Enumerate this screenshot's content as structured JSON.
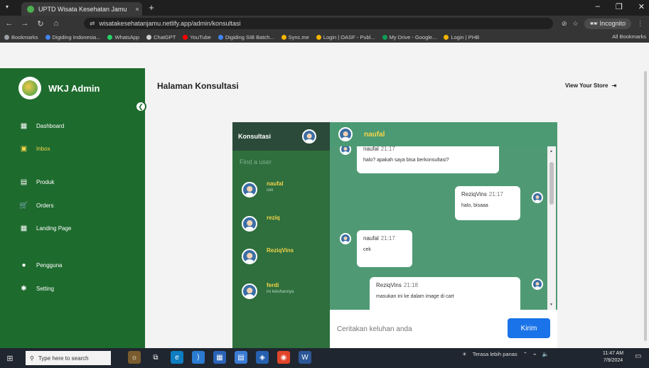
{
  "browser": {
    "tab_title": "UPTD Wisata Kesehatan Jamu",
    "tab_close": "×",
    "new_tab": "+",
    "url": "wisatakesehatanjamu.netlify.app/admin/konsultasi",
    "incognito_label": "Incognito",
    "bookmarks": [
      {
        "label": "Bookmarks",
        "color": "#9aa0a6"
      },
      {
        "label": "Digiding Indonesia...",
        "color": "#4285f4"
      },
      {
        "label": "WhatsApp",
        "color": "#25d366"
      },
      {
        "label": "ChatGPT",
        "color": "#cfcfcf"
      },
      {
        "label": "YouTube",
        "color": "#ff0000"
      },
      {
        "label": "Digiding SIB Batch...",
        "color": "#4285f4"
      },
      {
        "label": "Sync.me",
        "color": "#f4b400"
      },
      {
        "label": "Login | OASF - Publ...",
        "color": "#f4b400"
      },
      {
        "label": "My Drive - Google...",
        "color": "#0f9d58"
      },
      {
        "label": "Login | PHB",
        "color": "#f4b400"
      }
    ],
    "all_bookmarks": "All Bookmarks"
  },
  "sidebar": {
    "brand": "WKJ Admin",
    "items": [
      {
        "label": "Dashboard",
        "icon": "dashboard-icon"
      },
      {
        "label": "Inbox",
        "icon": "inbox-icon",
        "active": true
      },
      {
        "label": "Produk",
        "icon": "product-icon"
      },
      {
        "label": "Orders",
        "icon": "cart-icon"
      },
      {
        "label": "Landing Page",
        "icon": "landing-icon"
      },
      {
        "label": "Pengguna",
        "icon": "user-icon"
      },
      {
        "label": "Setting",
        "icon": "gear-icon"
      }
    ]
  },
  "main": {
    "title": "Halaman Konsultasi",
    "store_link": "View Your Store"
  },
  "chat": {
    "list_title": "Konsultasi",
    "search_placeholder": "Find a user",
    "users": [
      {
        "name": "naufal",
        "last": "cek"
      },
      {
        "name": "reziq",
        "last": ""
      },
      {
        "name": "ReziqVins",
        "last": ""
      },
      {
        "name": "ferdi",
        "last": "ini keluhannya"
      }
    ],
    "active_user": "naufal",
    "messages": [
      {
        "sender": "naufal",
        "time": "21:17",
        "text": "halo? apakah saya bisa berkonsultasi?"
      },
      {
        "sender": "ReziqVins",
        "time": "21:17",
        "text": "halo, bisaaa"
      },
      {
        "sender": "naufal",
        "time": "21:17",
        "text": "cek"
      },
      {
        "sender": "ReziqVins",
        "time": "21:18",
        "text": "masukan ini ke dalam image di cart"
      }
    ],
    "composer_placeholder": "Ceritakan keluhan anda",
    "send_label": "Kirim"
  },
  "taskbar": {
    "search_placeholder": "Type here to search",
    "weather": "Terasa lebih panas",
    "time": "11:47 AM",
    "date": "7/9/2024"
  }
}
